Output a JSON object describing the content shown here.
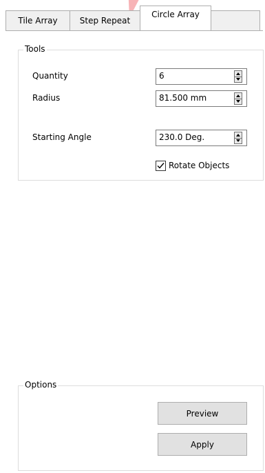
{
  "tabs": [
    {
      "label": "Tile Array"
    },
    {
      "label": "Step Repeat"
    },
    {
      "label": "Circle Array"
    }
  ],
  "active_tab": "Circle Array",
  "tools": {
    "group_label": "Tools",
    "quantity": {
      "label": "Quantity",
      "value": "6"
    },
    "radius": {
      "label": "Radius",
      "value": "81.500 mm"
    },
    "starting_angle": {
      "label": "Starting Angle",
      "value": "230.0 Deg."
    },
    "rotate_objects": {
      "label": "Rotate Objects",
      "checked": true
    }
  },
  "options": {
    "group_label": "Options",
    "preview_label": "Preview",
    "apply_label": "Apply"
  },
  "colors": {
    "watermark": "#e8262d",
    "border": "#adadad",
    "button_bg": "#e1e1e1"
  },
  "icons": {
    "spin_up": "triangle-up",
    "spin_down": "triangle-down",
    "check": "checkmark"
  }
}
